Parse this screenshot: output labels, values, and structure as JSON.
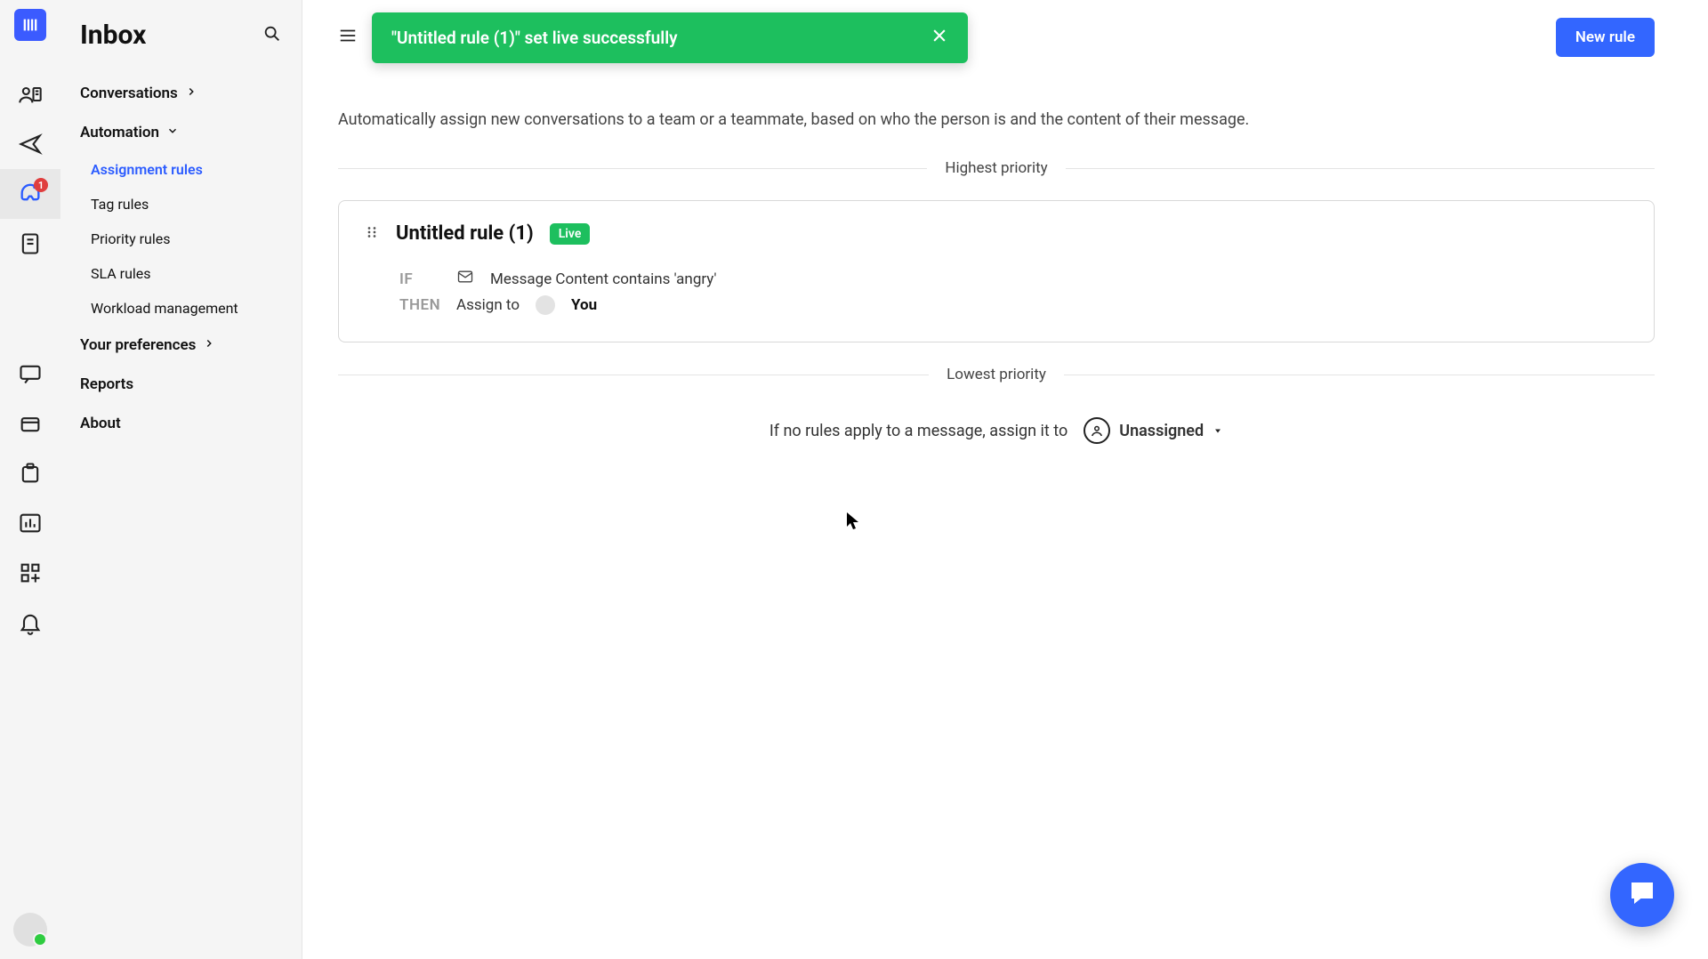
{
  "rail": {
    "badge_count": "1"
  },
  "sidebar": {
    "title": "Inbox",
    "conversations_label": "Conversations",
    "automation_label": "Automation",
    "automation_items": {
      "assignment": "Assignment rules",
      "tag": "Tag rules",
      "priority": "Priority rules",
      "sla": "SLA rules",
      "workload": "Workload management"
    },
    "preferences_label": "Your preferences",
    "reports_label": "Reports",
    "about_label": "About"
  },
  "toast": {
    "message": "\"Untitled rule (1)\" set live successfully"
  },
  "new_rule_button": "New rule",
  "description": "Automatically assign new conversations to a team or a teammate, based on who the person is and the content of their message.",
  "divider_highest": "Highest priority",
  "divider_lowest": "Lowest priority",
  "rule": {
    "name": "Untitled rule (1)",
    "status": "Live",
    "if_label": "IF",
    "then_label": "THEN",
    "condition_text": "Message Content contains 'angry'",
    "action_prefix": "Assign to",
    "action_target": "You"
  },
  "fallback": {
    "text": "If no rules apply to a message, assign it to",
    "value": "Unassigned"
  }
}
